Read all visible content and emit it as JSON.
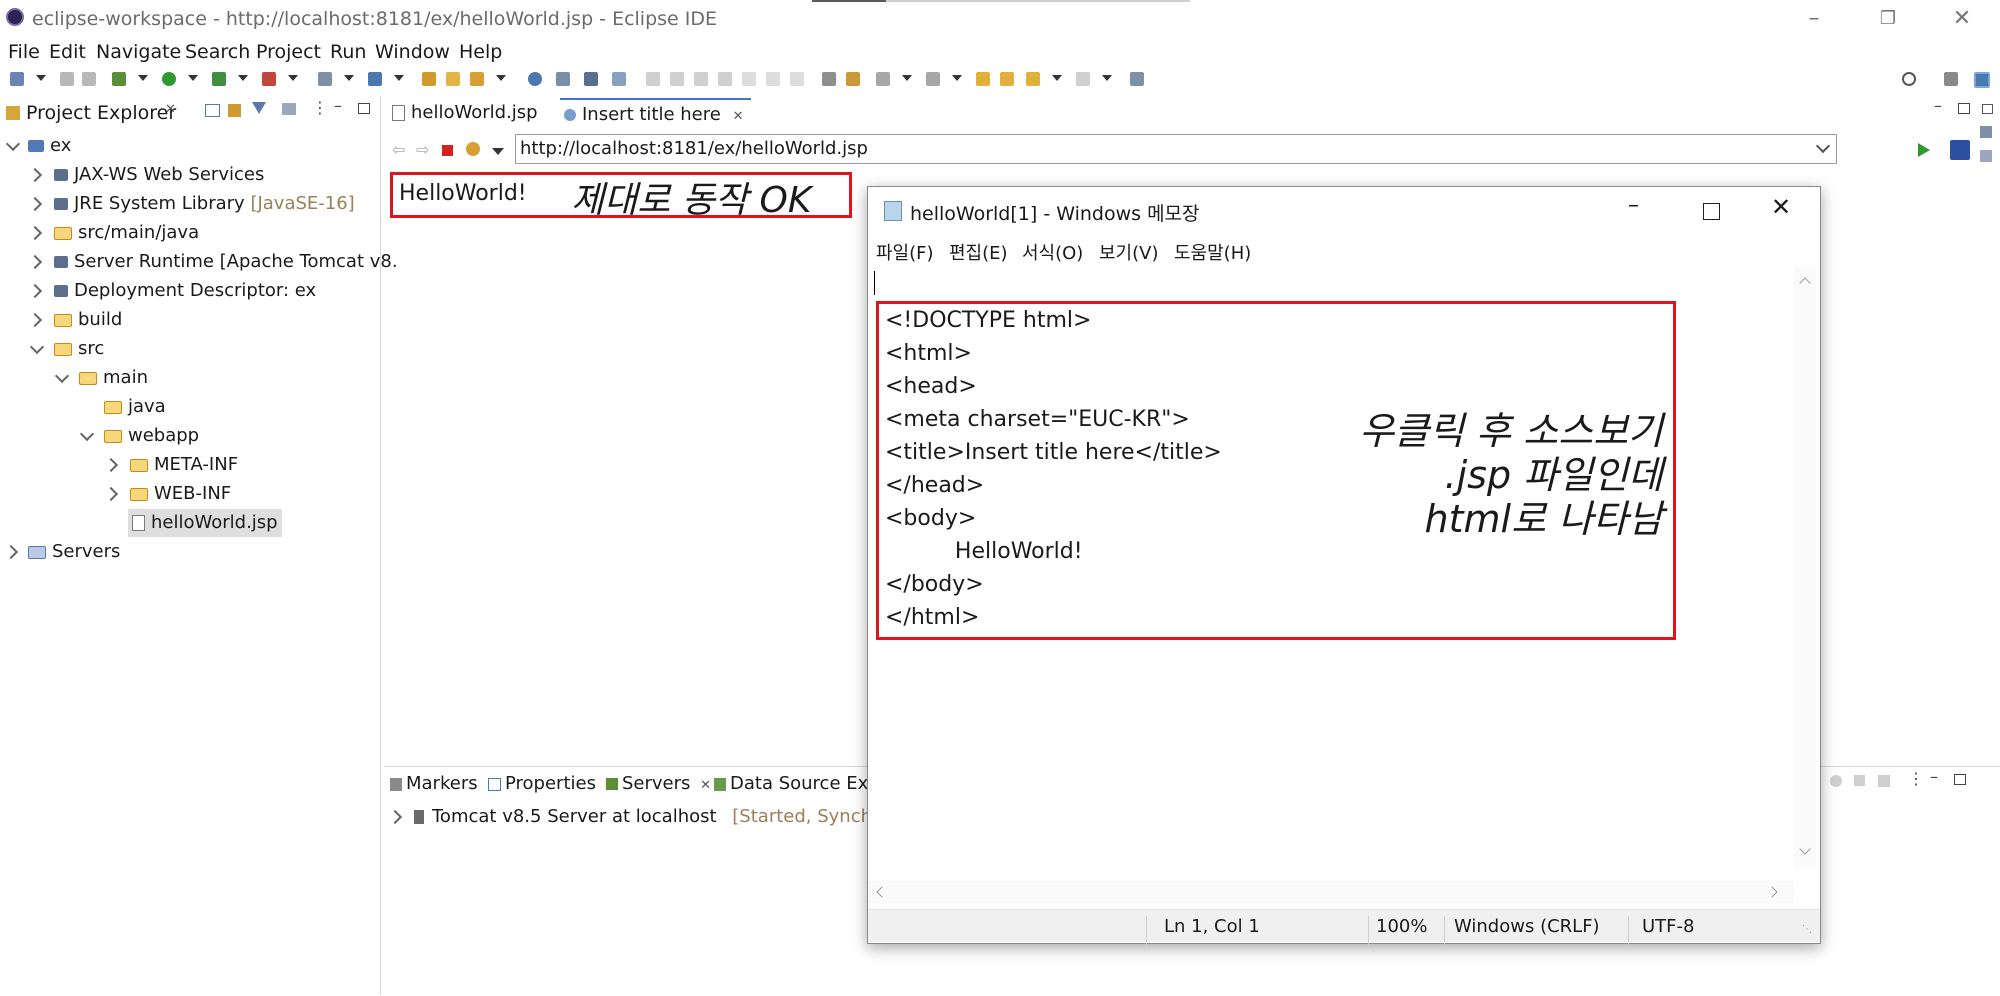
{
  "window": {
    "title": "eclipse-workspace - http://localhost:8181/ex/helloWorld.jsp - Eclipse IDE"
  },
  "menu": [
    "File",
    "Edit",
    "Navigate",
    "Search",
    "Project",
    "Run",
    "Window",
    "Help"
  ],
  "project_explorer": {
    "tab_label": "Project Explorer",
    "tree": [
      {
        "label": "ex",
        "suffix": ""
      },
      {
        "label": "JAX-WS Web Services",
        "suffix": ""
      },
      {
        "label": "JRE System Library",
        "suffix": "[JavaSE-16]"
      },
      {
        "label": "src/main/java",
        "suffix": ""
      },
      {
        "label": "Server Runtime [Apache Tomcat v8.",
        "suffix": ""
      },
      {
        "label": "Deployment Descriptor: ex",
        "suffix": ""
      },
      {
        "label": "build",
        "suffix": ""
      },
      {
        "label": "src",
        "suffix": ""
      },
      {
        "label": "main",
        "suffix": ""
      },
      {
        "label": "java",
        "suffix": ""
      },
      {
        "label": "webapp",
        "suffix": ""
      },
      {
        "label": "META-INF",
        "suffix": ""
      },
      {
        "label": "WEB-INF",
        "suffix": ""
      },
      {
        "label": "helloWorld.jsp",
        "suffix": ""
      },
      {
        "label": "Servers",
        "suffix": ""
      }
    ]
  },
  "editor": {
    "tabs": [
      {
        "label": "helloWorld.jsp"
      },
      {
        "label": "Insert title here"
      }
    ],
    "url": "http://localhost:8181/ex/helloWorld.jsp",
    "page_text": "HelloWorld!",
    "annotation": "제대로 동작 OK"
  },
  "bottom_panel": {
    "tabs": [
      "Markers",
      "Properties",
      "Servers",
      "Data Source Exp"
    ],
    "server_row": "Tomcat v8.5 Server at localhost",
    "server_status": "[Started, Synchron"
  },
  "notepad": {
    "title": "helloWorld[1] - Windows 메모장",
    "menu": [
      "파일(F)",
      "편집(E)",
      "서식(O)",
      "보기(V)",
      "도움말(H)"
    ],
    "code_lines": [
      "<!DOCTYPE html>",
      "<html>",
      "<head>",
      "<meta charset=\"EUC-KR\">",
      "<title>Insert title here</title>",
      "</head>",
      "<body>",
      "          HelloWorld!",
      "</body>",
      "</html>"
    ],
    "annotation": [
      "우클릭 후 소스보기",
      ".jsp 파일인데",
      "html로 나타남"
    ],
    "status": {
      "position": "Ln 1, Col 1",
      "zoom": "100%",
      "line_ending": "Windows (CRLF)",
      "encoding": "UTF-8"
    }
  }
}
